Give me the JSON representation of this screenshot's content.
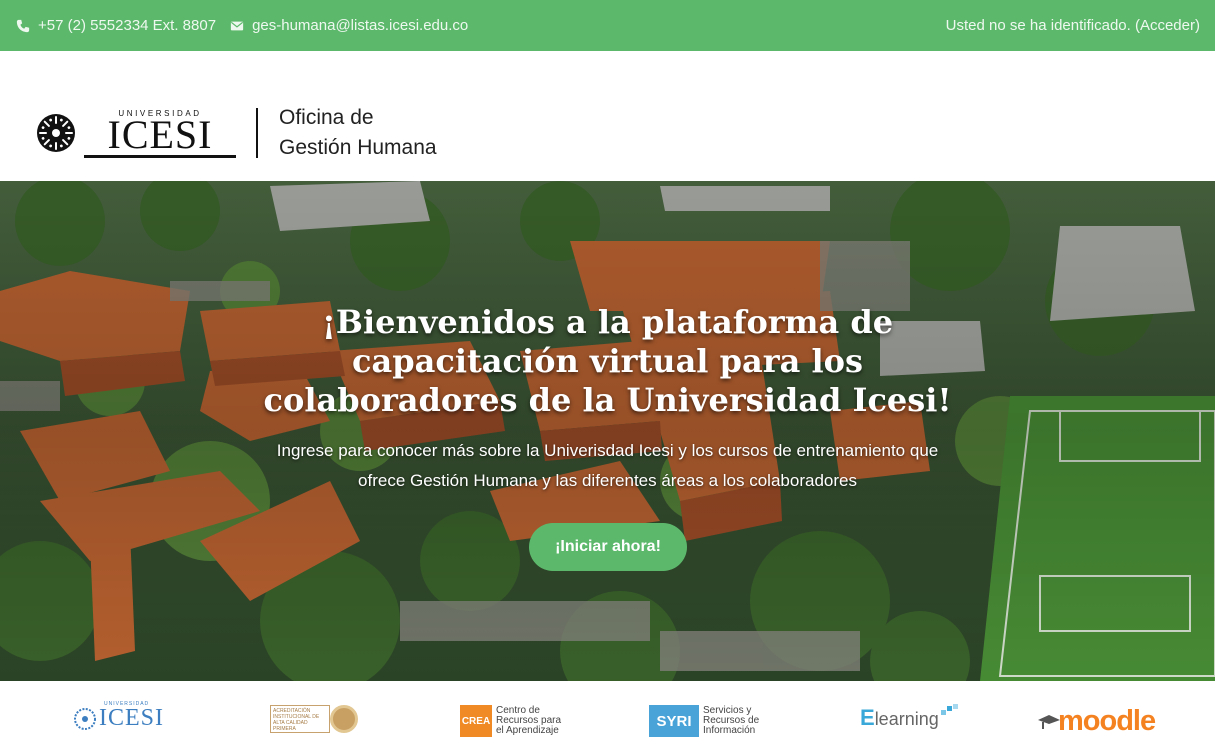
{
  "topbar": {
    "phone": "+57 (2) 5552334 Ext. 8807",
    "email": "ges-humana@listas.icesi.edu.co",
    "login_status": "Usted no se ha identificado.",
    "login_link": "(Acceder)",
    "background_color": "#5cb96c"
  },
  "header": {
    "logo_university": "UNIVERSIDAD",
    "logo_name": "ICESI",
    "office_line1": "Oficina de",
    "office_line2": "Gestión Humana"
  },
  "hero": {
    "title": "¡Bienvenidos a la plataforma de capacitación virtual para los colaboradores de la Universidad Icesi!",
    "subtitle": "Ingrese para conocer más sobre la Univerisdad Icesi y los cursos de entrenamiento que ofrece Gestión Humana y las diferentes áreas a los colaboradores",
    "cta_label": "¡Iniciar ahora!",
    "cta_color": "#5cb96c"
  },
  "partners": {
    "icesi": {
      "university": "UNIVERSIDAD",
      "name": "ICESI"
    },
    "acreditacion": {
      "text": "ACREDITACIÓN INSTITUCIONAL DE ALTA CALIDAD PRIMERA UNIVERSIDAD PRIVADA DEL SUROCCIDENTE COLOMBIANO"
    },
    "crea": {
      "badge": "CREA",
      "text": "Centro de Recursos para el Aprendizaje"
    },
    "syri": {
      "badge": "SYRI",
      "text": "Servicios y Recursos de Información"
    },
    "elearning": {
      "initial": "E",
      "text": "learning"
    },
    "moodle": {
      "text": "moodle"
    }
  }
}
